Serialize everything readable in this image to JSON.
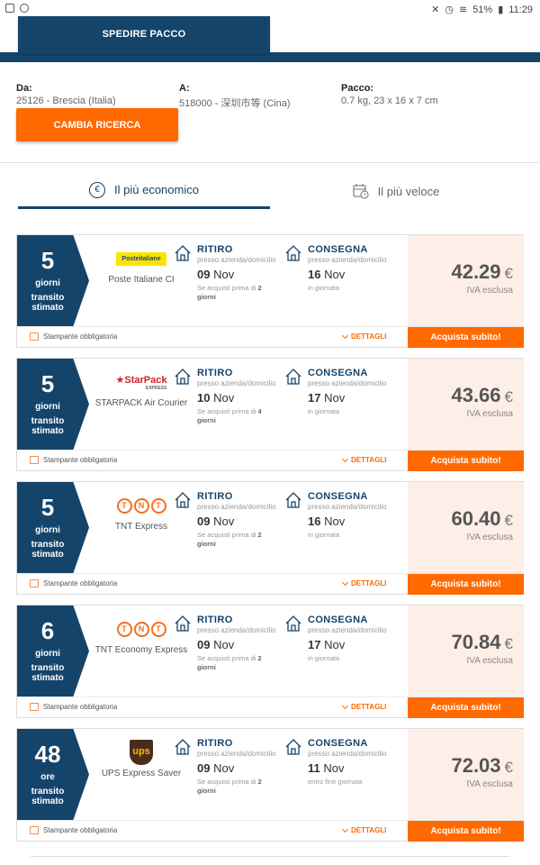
{
  "statusbar": {
    "battery": "51%",
    "time": "11:29"
  },
  "header": {
    "tab_label": "SPEDIRE PACCO"
  },
  "search": {
    "from_label": "Da:",
    "from_value": "25126 - Brescia (Italia)",
    "to_label": "A:",
    "to_value": "518000 - 深圳市等 (Cina)",
    "package_label": "Pacco:",
    "package_value": "0.7 kg, 23 x 16 x 7 cm",
    "change_button": "CAMBIA RICERCA"
  },
  "sort_tabs": {
    "cheapest": "Il più economico",
    "fastest": "Il più veloce"
  },
  "labels": {
    "pickup": "RITIRO",
    "pickup_sub": "presso azienda/domicilio",
    "delivery": "CONSEGNA",
    "delivery_sub": "presso azienda/domicilio",
    "transit_line1": "transito",
    "transit_line2": "stimato",
    "vat": "IVA esclusa",
    "printer": "Stampante obbligatoria",
    "details": "DETTAGLI",
    "buy": "Acquista subito!",
    "currency": "€"
  },
  "offers": [
    {
      "transit_num": "5",
      "transit_unit": "giorni",
      "carrier": "Poste Italiane CI",
      "logo": "poste-italiane-logo",
      "logo_text": "Posteitaliane",
      "pickup_day": "09",
      "pickup_month": "Nov",
      "pickup_note_pre": "Se acquisti prima di",
      "pickup_note_num": "2",
      "pickup_note_unit": "giorni",
      "delivery_day": "16",
      "delivery_month": "Nov",
      "delivery_note": "in giornata",
      "price": "42.29"
    },
    {
      "transit_num": "5",
      "transit_unit": "giorni",
      "carrier": "STARPACK Air Courier",
      "logo": "starpack-logo",
      "logo_text": "StarPack",
      "logo_sub": "EXPRESS",
      "pickup_day": "10",
      "pickup_month": "Nov",
      "pickup_note_pre": "Se acquisti prima di",
      "pickup_note_num": "4",
      "pickup_note_unit": "giorni",
      "delivery_day": "17",
      "delivery_month": "Nov",
      "delivery_note": "in giornata",
      "price": "43.66"
    },
    {
      "transit_num": "5",
      "transit_unit": "giorni",
      "carrier": "TNT Express",
      "logo": "tnt-logo",
      "pickup_day": "09",
      "pickup_month": "Nov",
      "pickup_note_pre": "Se acquisti prima di",
      "pickup_note_num": "2",
      "pickup_note_unit": "giorni",
      "delivery_day": "16",
      "delivery_month": "Nov",
      "delivery_note": "in giornata",
      "price": "60.40"
    },
    {
      "transit_num": "6",
      "transit_unit": "giorni",
      "carrier": "TNT Economy Express",
      "logo": "tnt-logo",
      "pickup_day": "09",
      "pickup_month": "Nov",
      "pickup_note_pre": "Se acquisti prima di",
      "pickup_note_num": "2",
      "pickup_note_unit": "giorni",
      "delivery_day": "17",
      "delivery_month": "Nov",
      "delivery_note": "in giornata",
      "price": "70.84"
    },
    {
      "transit_num": "48",
      "transit_unit": "ore",
      "carrier": "UPS Express Saver",
      "logo": "ups-logo",
      "logo_text": "ups",
      "pickup_day": "09",
      "pickup_month": "Nov",
      "pickup_note_pre": "Se acquisti prima di",
      "pickup_note_num": "2",
      "pickup_note_unit": "giorni",
      "delivery_day": "11",
      "delivery_month": "Nov",
      "delivery_note": "entro fine giornata",
      "price": "72.03"
    }
  ]
}
